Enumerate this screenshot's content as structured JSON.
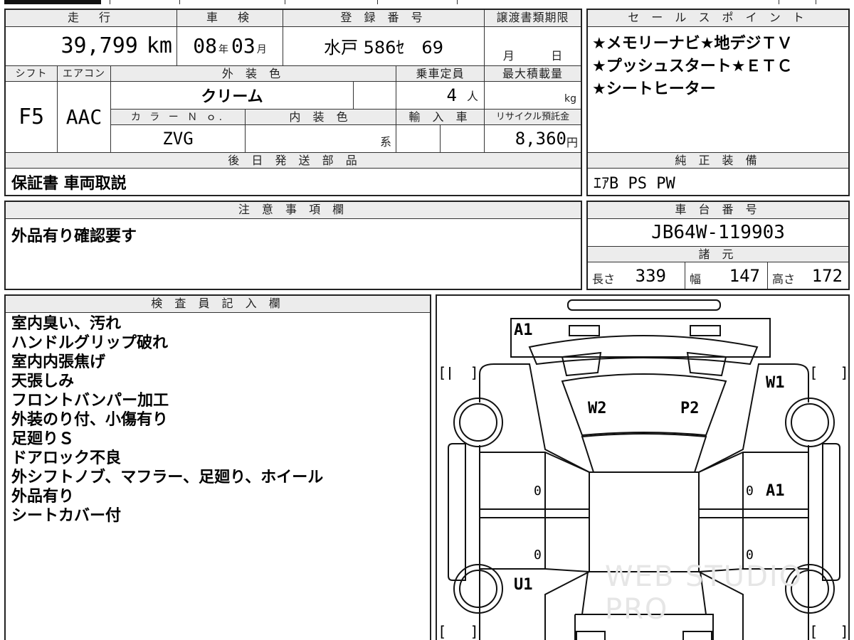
{
  "mileage": {
    "label": "走　行",
    "value": "39,799",
    "unit": "km"
  },
  "inspection": {
    "label": "車　検",
    "year": "08",
    "year_unit": "年",
    "month": "03",
    "month_unit": "月"
  },
  "registration": {
    "label": "登 録 番 号",
    "value": "水戸 586ｾ　69"
  },
  "transfer": {
    "label": "譲渡書類期限",
    "month_unit": "月",
    "day_unit": "日"
  },
  "shift": {
    "label": "シフト",
    "value": "F5"
  },
  "aircon": {
    "label": "エアコン",
    "value": "AAC"
  },
  "exterior_color": {
    "label": "外 装 色",
    "value": "クリーム"
  },
  "capacity": {
    "label": "乗車定員",
    "value": "4",
    "unit": "人"
  },
  "max_load": {
    "label": "最大積載量",
    "unit": "kg"
  },
  "color_no": {
    "label": "カ ラ ー Ｎ ｏ.",
    "value": "ZVG"
  },
  "interior_color": {
    "label": "内 装 色",
    "unit": "系"
  },
  "import": {
    "label": "輸 入 車"
  },
  "recycle": {
    "label": "リサイクル預託金",
    "value": "8,360",
    "unit": "円"
  },
  "later_parts": {
    "label": "後 日 発 送 部 品",
    "value": "保証書 車両取説"
  },
  "sales_points": {
    "label": "セ ー ル ス ポ イ ン ト",
    "lines": [
      "★メモリーナビ★地デジＴＶ",
      "★プッシュスタート★ＥＴＣ",
      "★シートヒーター"
    ]
  },
  "genuine": {
    "label": "純 正 装 備",
    "value": "ｴｱB PS PW"
  },
  "notes": {
    "label": "注 意 事 項 欄",
    "value": "外品有り確認要す"
  },
  "chassis": {
    "label": "車 台 番 号",
    "value": "JB64W-119903"
  },
  "specs": {
    "label": "諸 元",
    "length_label": "長さ",
    "length": "339",
    "width_label": "幅",
    "width": "147",
    "height_label": "高さ",
    "height": "172"
  },
  "inspector": {
    "label": "検 査 員 記 入 欄",
    "lines": [
      "室内臭い、汚れ",
      "ハンドルグリップ破れ",
      "室内内張焦げ",
      "天張しみ",
      "フロントバンパー加工",
      "外装のり付、小傷有り",
      "足廻りＳ",
      "ドアロック不良",
      "外シフトノブ、マフラー、足廻り、ホイール",
      "外品有り",
      "シートカバー付"
    ]
  },
  "diagram": {
    "marks": {
      "front_bumper": "A1",
      "right_front_fender": "W1",
      "windshield_left": "W2",
      "windshield_right": "P2",
      "left_door_front": "0",
      "left_door_rear": "0",
      "right_door_front": "0",
      "right_door_front_mark": "A1",
      "left_rear": "U1"
    },
    "bracket_open": "[",
    "bracket_close": "]",
    "watermark": "WEB STUDIO PRO"
  }
}
